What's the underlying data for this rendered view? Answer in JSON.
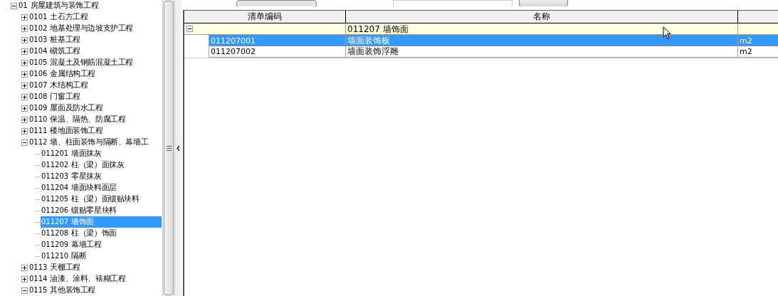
{
  "tree": [
    {
      "code": "01",
      "name": "房屋建筑与装饰工程",
      "expanded": true,
      "selected": false,
      "children": [
        {
          "code": "0101",
          "name": "土石方工程",
          "expanded": false,
          "selected": false
        },
        {
          "code": "0102",
          "name": "地基处理与边坡支护工程",
          "expanded": false,
          "selected": false
        },
        {
          "code": "0103",
          "name": "桩基工程",
          "expanded": false,
          "selected": false
        },
        {
          "code": "0104",
          "name": "砌筑工程",
          "expanded": false,
          "selected": false
        },
        {
          "code": "0105",
          "name": "混凝土及钢筋混凝土工程",
          "expanded": false,
          "selected": false
        },
        {
          "code": "0106",
          "name": "金属结构工程",
          "expanded": false,
          "selected": false
        },
        {
          "code": "0107",
          "name": "木结构工程",
          "expanded": false,
          "selected": false
        },
        {
          "code": "0108",
          "name": "门窗工程",
          "expanded": false,
          "selected": false
        },
        {
          "code": "0109",
          "name": "屋面及防水工程",
          "expanded": false,
          "selected": false
        },
        {
          "code": "0110",
          "name": "保温、隔热、防腐工程",
          "expanded": false,
          "selected": false
        },
        {
          "code": "0111",
          "name": "楼地面装饰工程",
          "expanded": false,
          "selected": false
        },
        {
          "code": "0112",
          "name": "墙、柱面装饰与隔断、幕墙工",
          "expanded": true,
          "selected": false,
          "children": [
            {
              "code": "011201",
              "name": "墙面抹灰",
              "selected": false
            },
            {
              "code": "011202",
              "name": "柱（梁）面抹灰",
              "selected": false
            },
            {
              "code": "011203",
              "name": "零星抹灰",
              "selected": false
            },
            {
              "code": "011204",
              "name": "墙面块料面层",
              "selected": false
            },
            {
              "code": "011205",
              "name": "柱（梁）面镶贴块料",
              "selected": false
            },
            {
              "code": "011206",
              "name": "镶贴零星块料",
              "selected": false
            },
            {
              "code": "011207",
              "name": "墙饰面",
              "selected": true
            },
            {
              "code": "011208",
              "name": "柱（梁）饰面",
              "selected": false
            },
            {
              "code": "011209",
              "name": "幕墙工程",
              "selected": false
            },
            {
              "code": "011210",
              "name": "隔断",
              "selected": false
            }
          ]
        },
        {
          "code": "0113",
          "name": "天棚工程",
          "expanded": false,
          "selected": false
        },
        {
          "code": "0114",
          "name": "油漆、涂料、裱糊工程",
          "expanded": false,
          "selected": false
        },
        {
          "code": "0115",
          "name": "其他装饰工程",
          "expanded": true,
          "selected": false
        }
      ]
    }
  ],
  "grid": {
    "columns": [
      "清单编码",
      "名称"
    ],
    "rows": [
      {
        "kind": "group",
        "expanded": true,
        "name": "011207 墙饰面"
      },
      {
        "kind": "item",
        "selected": true,
        "code": "011207001",
        "name": "墙面装饰板",
        "unit": "m2"
      },
      {
        "kind": "item",
        "selected": false,
        "code": "011207002",
        "name": "墙面装饰浮雕",
        "unit": "m2"
      }
    ]
  }
}
